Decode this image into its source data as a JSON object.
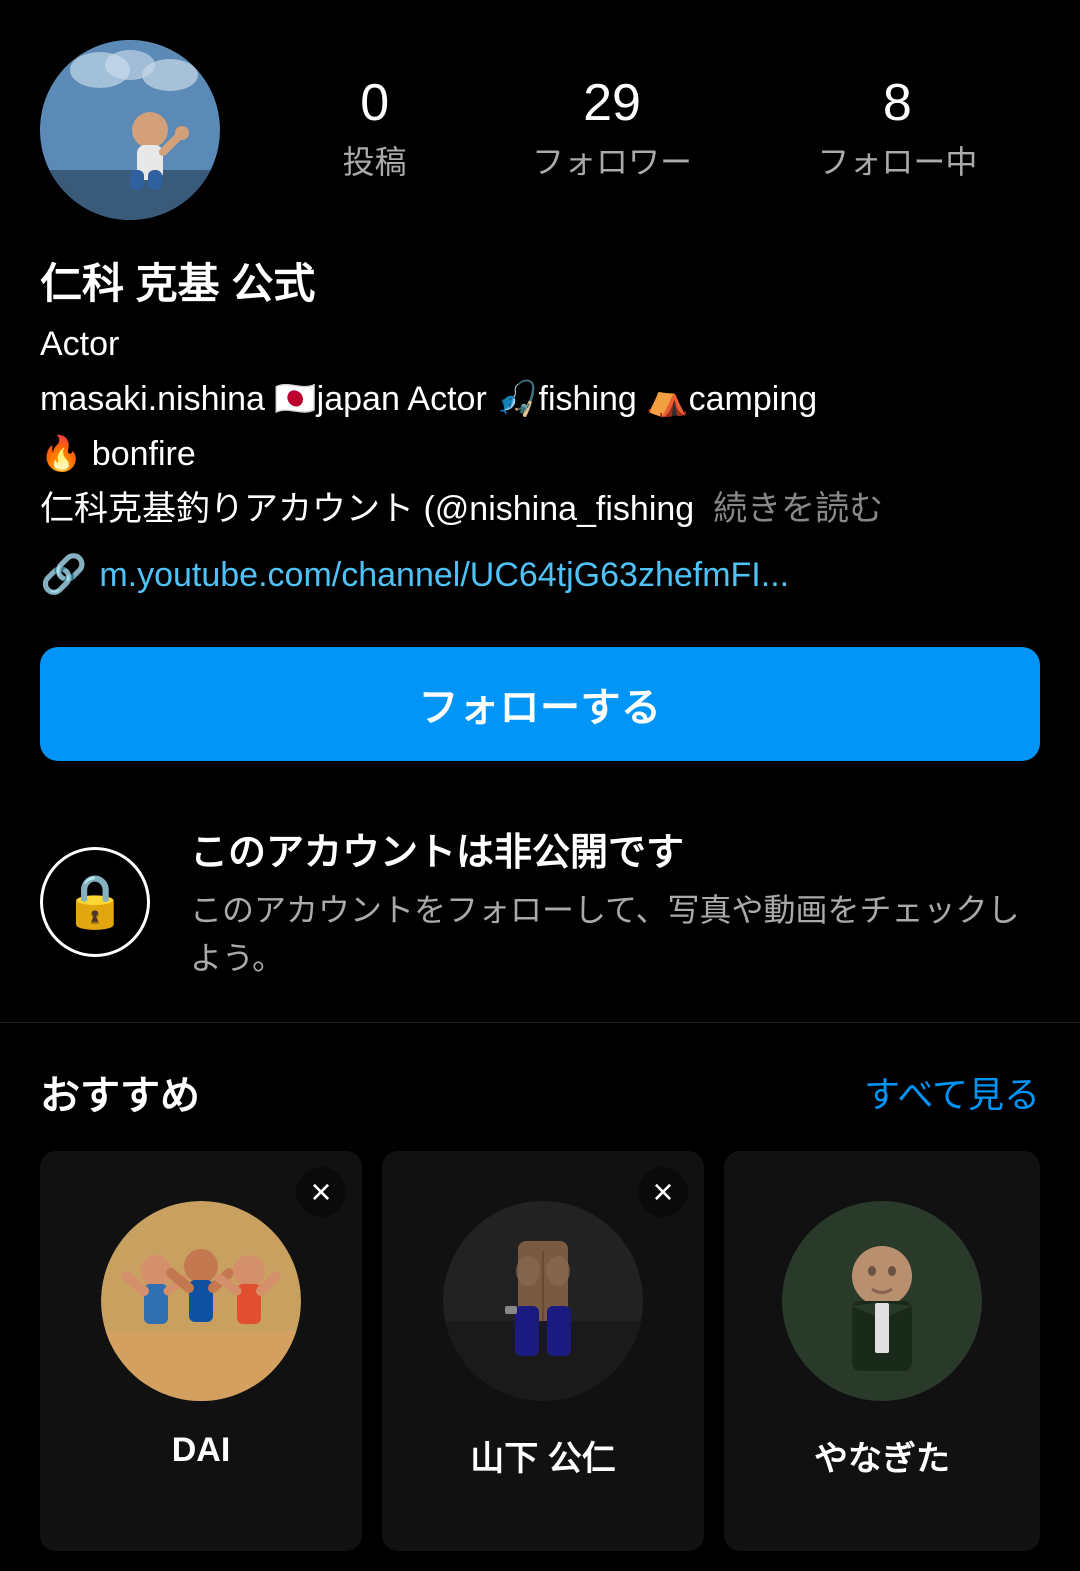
{
  "profile": {
    "display_name": "仁科 克基 公式",
    "title": "Actor",
    "bio_line1": "masaki.nishina 🇯🇵japan  Actor  🎣fishing    ⛺camping",
    "bio_line2": "🔥 bonfire",
    "bio_line3": "仁科克基釣りアカウント (@nishina_fishing",
    "read_more": "続きを読む",
    "link_url": "m.youtube.com/channel/UC64tjG63zhefmFI...",
    "stats": {
      "posts_count": "0",
      "posts_label": "投稿",
      "followers_count": "29",
      "followers_label": "フォロワー",
      "following_count": "8",
      "following_label": "フォロー中"
    }
  },
  "follow_button": {
    "label": "フォローする"
  },
  "private_notice": {
    "title": "このアカウントは非公開です",
    "description": "このアカウントをフォローして、写真や動画をチェックしよう。"
  },
  "recommended": {
    "title": "おすすめ",
    "see_all": "すべて見る",
    "cards": [
      {
        "name": "DAI",
        "sub": ""
      },
      {
        "name": "山下 公仁",
        "sub": ""
      },
      {
        "name": "やなぎた",
        "sub": ""
      }
    ]
  },
  "icons": {
    "link": "🔗",
    "lock": "🔒",
    "close": "×"
  },
  "colors": {
    "follow_blue": "#0095f6",
    "link_blue": "#4fc3f7",
    "see_all_blue": "#0095f6",
    "bg": "#000000",
    "card_bg": "#111111"
  }
}
